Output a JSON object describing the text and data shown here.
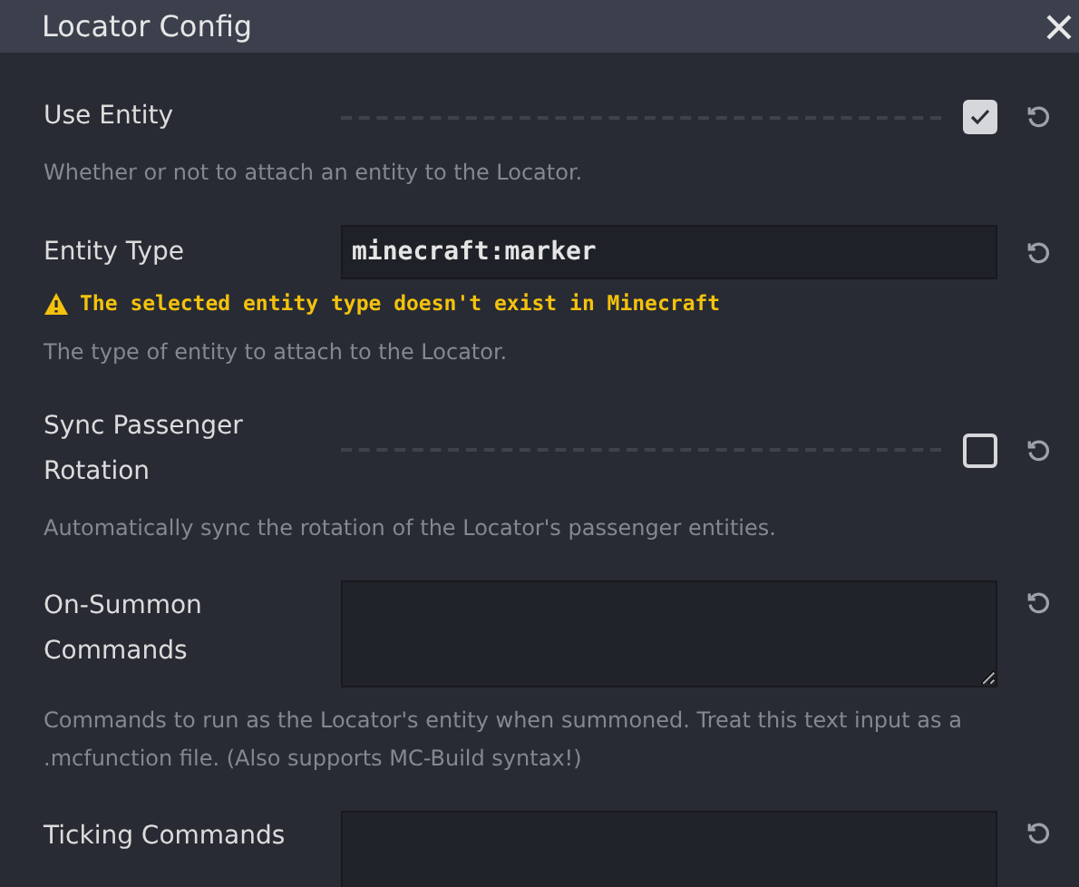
{
  "window": {
    "title": "Locator Config"
  },
  "fields": [
    {
      "kind": "checkbox",
      "label": "Use Entity",
      "checked": true,
      "description": "Whether or not to attach an entity to the Locator."
    },
    {
      "kind": "text",
      "label": "Entity Type",
      "value": "minecraft:marker",
      "warning": "The selected entity type doesn't exist in Minecraft",
      "description": "The type of entity to attach to the Locator."
    },
    {
      "kind": "checkbox",
      "label": "Sync Passenger Rotation",
      "checked": false,
      "description": "Automatically sync the rotation of the Locator's passenger entities."
    },
    {
      "kind": "textarea",
      "label": "On-Summon Commands",
      "description": "Commands to run as the Locator's entity when summoned. Treat this text input as a .mcfunction file. (Also supports MC-Build syntax!)"
    },
    {
      "kind": "textarea",
      "label": "Ticking Commands"
    }
  ]
}
